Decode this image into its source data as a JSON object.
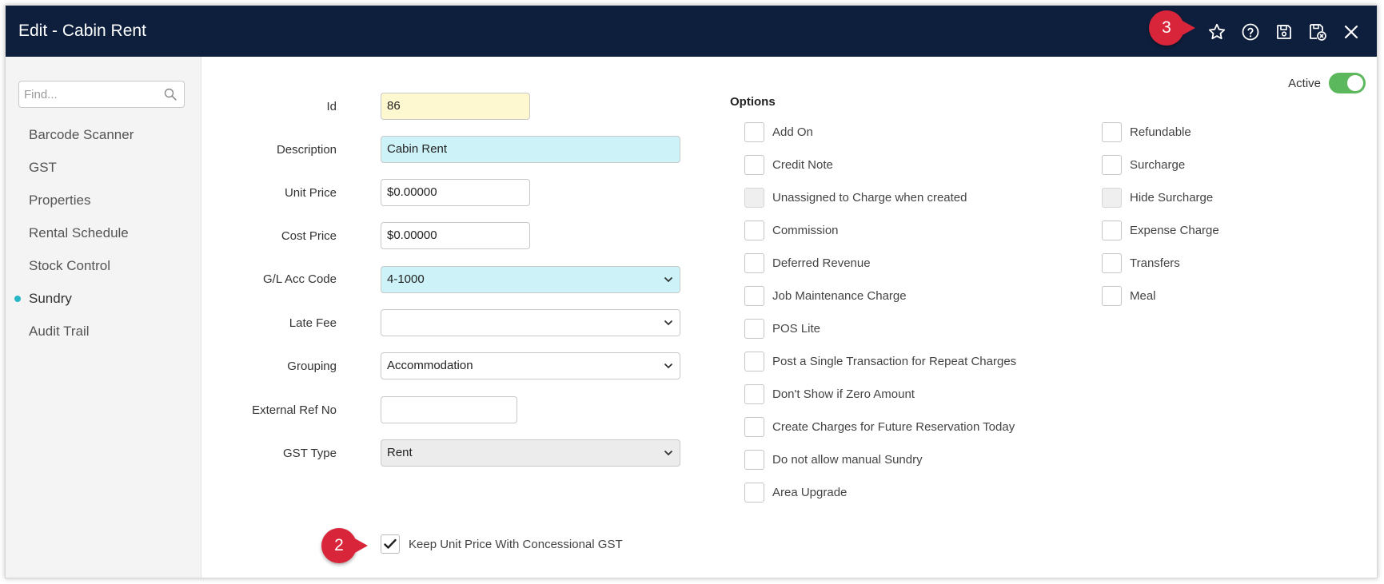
{
  "window": {
    "title": "Edit - Cabin Rent"
  },
  "toolbar": {
    "icons": [
      "star-icon",
      "help-icon",
      "save-icon",
      "save-close-icon",
      "close-icon"
    ]
  },
  "sidebar": {
    "search_placeholder": "Find...",
    "items": [
      {
        "label": "Barcode Scanner",
        "active": false
      },
      {
        "label": "GST",
        "active": false
      },
      {
        "label": "Properties",
        "active": false
      },
      {
        "label": "Rental Schedule",
        "active": false
      },
      {
        "label": "Stock Control",
        "active": false
      },
      {
        "label": "Sundry",
        "active": true
      },
      {
        "label": "Audit Trail",
        "active": false
      }
    ]
  },
  "status": {
    "active_label": "Active",
    "active": true
  },
  "form": {
    "id": {
      "label": "Id",
      "value": "86"
    },
    "description": {
      "label": "Description",
      "value": "Cabin Rent"
    },
    "unit_price": {
      "label": "Unit Price",
      "value": "$0.00000"
    },
    "cost_price": {
      "label": "Cost Price",
      "value": "$0.00000"
    },
    "gl_acc_code": {
      "label": "G/L Acc Code",
      "value": "4-1000"
    },
    "late_fee": {
      "label": "Late Fee",
      "value": ""
    },
    "grouping": {
      "label": "Grouping",
      "value": "Accommodation"
    },
    "external_ref": {
      "label": "External Ref No",
      "value": ""
    },
    "gst_type": {
      "label": "GST Type",
      "value": "Rent"
    },
    "keep_unit_price": {
      "label": "Keep Unit Price With Concessional GST",
      "checked": true
    }
  },
  "options": {
    "title": "Options",
    "left": [
      {
        "label": "Add On",
        "checked": false,
        "disabled": false
      },
      {
        "label": "Credit Note",
        "checked": false,
        "disabled": false
      },
      {
        "label": "Unassigned to Charge when created",
        "checked": false,
        "disabled": true
      },
      {
        "label": "Commission",
        "checked": false,
        "disabled": false
      },
      {
        "label": "Deferred Revenue",
        "checked": false,
        "disabled": false
      },
      {
        "label": "Job Maintenance Charge",
        "checked": false,
        "disabled": false
      },
      {
        "label": "POS Lite",
        "checked": false,
        "disabled": false
      },
      {
        "label": "Post a Single Transaction for Repeat Charges",
        "checked": false,
        "disabled": false
      },
      {
        "label": "Don't Show if Zero Amount",
        "checked": false,
        "disabled": false
      },
      {
        "label": "Create Charges for Future Reservation Today",
        "checked": false,
        "disabled": false
      },
      {
        "label": "Do not allow manual Sundry",
        "checked": false,
        "disabled": false
      },
      {
        "label": "Area Upgrade",
        "checked": false,
        "disabled": false
      }
    ],
    "right": [
      {
        "label": "Refundable",
        "checked": false,
        "disabled": false
      },
      {
        "label": "Surcharge",
        "checked": false,
        "disabled": false
      },
      {
        "label": "Hide Surcharge",
        "checked": false,
        "disabled": true
      },
      {
        "label": "Expense Charge",
        "checked": false,
        "disabled": false
      },
      {
        "label": "Transfers",
        "checked": false,
        "disabled": false
      },
      {
        "label": "Meal",
        "checked": false,
        "disabled": false
      }
    ]
  },
  "annotations": {
    "step2": "2",
    "step3": "3"
  },
  "colors": {
    "titlebar": "#0e1f3d",
    "accent": "#27b6c6",
    "marker": "#d9253a",
    "toggle_on": "#5cb85c"
  }
}
